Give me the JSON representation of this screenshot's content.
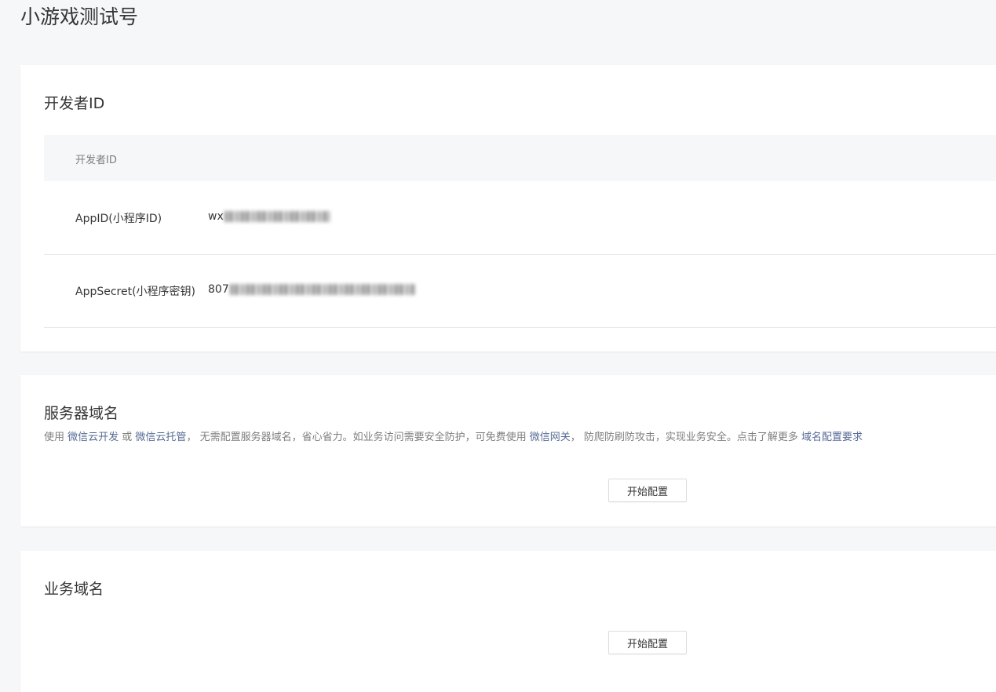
{
  "page": {
    "title": "小游戏测试号"
  },
  "developer_id": {
    "title": "开发者ID",
    "table_header": "开发者ID",
    "rows": [
      {
        "label": "AppID(小程序ID)",
        "value_visible_prefix": "wx"
      },
      {
        "label": "AppSecret(小程序密钥)",
        "value_visible_prefix": "807"
      }
    ]
  },
  "server_domain": {
    "title": "服务器域名",
    "description": {
      "t1": "使用 ",
      "link1": "微信云开发",
      "t2": " 或 ",
      "link2": "微信云托管",
      "t3": "， 无需配置服务器域名，省心省力。如业务访问需要安全防护，可免费使用 ",
      "link3": "微信网关",
      "t4": "， 防爬防刷防攻击，实现业务安全。点击了解更多 ",
      "link4": "域名配置要求"
    },
    "button_label": "开始配置"
  },
  "business_domain": {
    "title": "业务域名",
    "button_label": "开始配置"
  },
  "colors": {
    "background": "#f6f7f9",
    "card": "#ffffff",
    "link": "#576b95",
    "text": "#353535",
    "muted": "#7e7e7e"
  }
}
